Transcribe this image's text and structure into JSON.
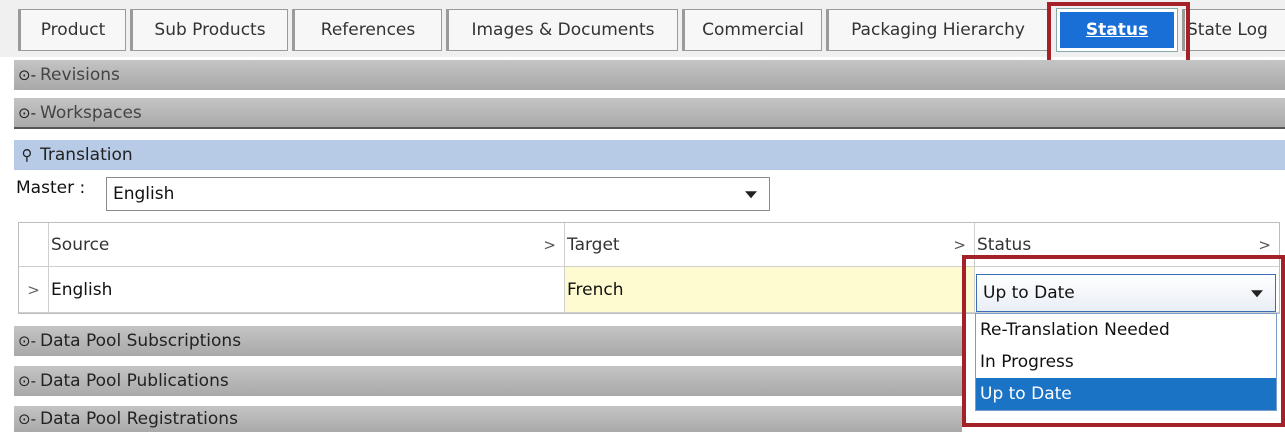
{
  "tabs": [
    {
      "label": "Product"
    },
    {
      "label": "Sub Products"
    },
    {
      "label": "References"
    },
    {
      "label": "Images & Documents"
    },
    {
      "label": "Commercial"
    },
    {
      "label": "Packaging Hierarchy"
    },
    {
      "label": "Status",
      "active": true
    },
    {
      "label": "State Log"
    }
  ],
  "sections": {
    "revisions": "Revisions",
    "workspaces": "Workspaces",
    "translation": "Translation",
    "dp_subscriptions": "Data Pool Subscriptions",
    "dp_publications": "Data Pool Publications",
    "dp_registrations": "Data Pool Registrations"
  },
  "master": {
    "label": "Master :",
    "value": "English"
  },
  "table": {
    "headers": [
      "Source",
      "Target",
      "Status"
    ],
    "rows": [
      {
        "source": "English",
        "target": "French",
        "status": "Up to Date"
      }
    ]
  },
  "status_options": [
    "Re-Translation Needed",
    "In Progress",
    "Up to Date"
  ],
  "selected_status": "Up to Date",
  "colors": {
    "accent": "#1a6fd6",
    "highlight_box": "#a52128",
    "target_cell": "#fffbd0",
    "translation_bar": "#b8cbe6"
  }
}
